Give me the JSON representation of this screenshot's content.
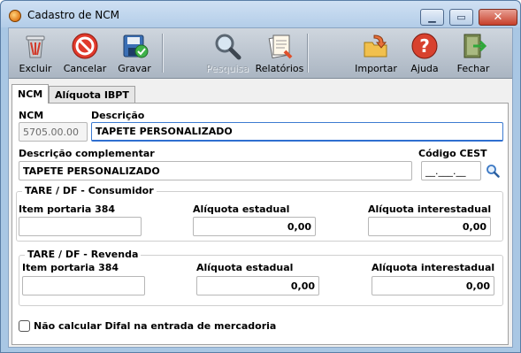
{
  "window": {
    "title": "Cadastro de NCM",
    "close_glyph": "✕",
    "max_glyph": "▭",
    "min_glyph": "▁"
  },
  "toolbar": {
    "excluir": "Excluir",
    "cancelar": "Cancelar",
    "gravar": "Gravar",
    "pesquisa": "Pesquisa",
    "relatorios": "Relatórios",
    "importar": "Importar",
    "ajuda": "Ajuda",
    "fechar": "Fechar"
  },
  "tabs": [
    {
      "label": "NCM",
      "active": true
    },
    {
      "label": "Alíquota IBPT",
      "active": false
    }
  ],
  "form": {
    "ncm_label": "NCM",
    "ncm_value": "5705.00.00",
    "descricao_label": "Descrição",
    "descricao_value": "TAPETE PERSONALIZADO",
    "desc_comp_label": "Descrição complementar",
    "desc_comp_value": "TAPETE PERSONALIZADO",
    "cest_label": "Código CEST",
    "cest_value": "__.___.__"
  },
  "consumidor": {
    "title": "TARE / DF - Consumidor",
    "item_label": "Item portaria 384",
    "item_value": "",
    "aliq_est_label": "Alíquota estadual",
    "aliq_est_value": "0,00",
    "aliq_inter_label": "Alíquota interestadual",
    "aliq_inter_value": "0,00"
  },
  "revenda": {
    "title": "TARE / DF - Revenda",
    "item_label": "Item portaria 384",
    "item_value": "",
    "aliq_est_label": "Alíquota estadual",
    "aliq_est_value": "0,00",
    "aliq_inter_label": "Alíquota interestadual",
    "aliq_inter_value": "0,00"
  },
  "difal": {
    "label": "Não calcular Difal na entrada de mercadoria",
    "checked": false
  },
  "colors": {
    "title_bar": "#b3cde8",
    "toolbar": "#aab5c2",
    "focus": "#2f6fd0",
    "close": "#c7402b"
  }
}
